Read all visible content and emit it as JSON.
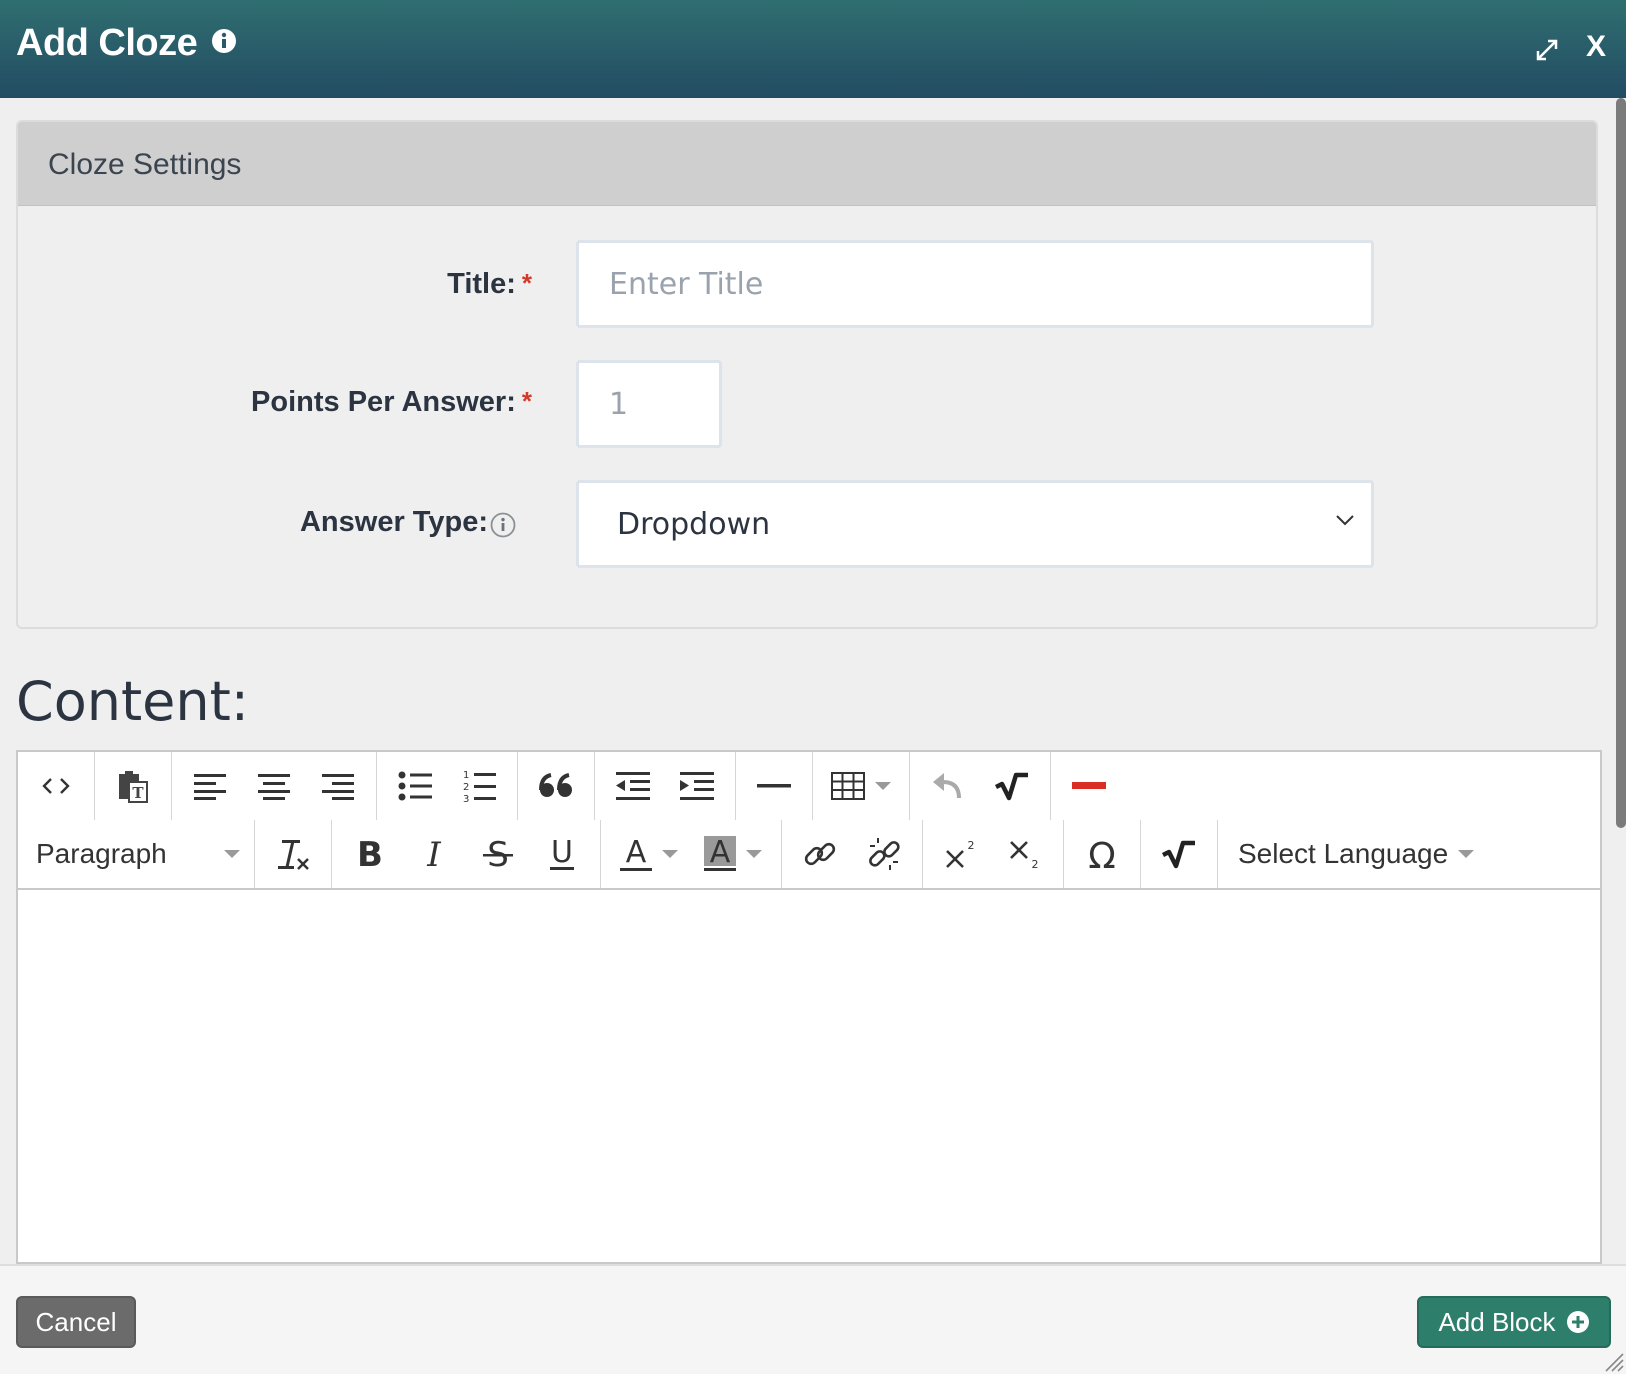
{
  "dialog": {
    "title": "Add Cloze",
    "close_label": "X"
  },
  "settings": {
    "heading": "Cloze Settings",
    "title_label": "Title:",
    "title_placeholder": "Enter Title",
    "points_label": "Points Per Answer:",
    "points_placeholder": "1",
    "answer_type_label": "Answer Type:",
    "answer_type_value": "Dropdown",
    "required_mark": "*"
  },
  "content": {
    "label": "Content:",
    "paragraph_label": "Paragraph",
    "language_label": "Select Language"
  },
  "footer": {
    "cancel_label": "Cancel",
    "add_block_label": "Add Block"
  },
  "colors": {
    "header_top": "#2f6e70",
    "header_bottom": "#234c63",
    "required": "#d43a2a",
    "add_button": "#2d7f6c",
    "cancel_button": "#6b6b6b",
    "remove_red": "#d92e24"
  }
}
